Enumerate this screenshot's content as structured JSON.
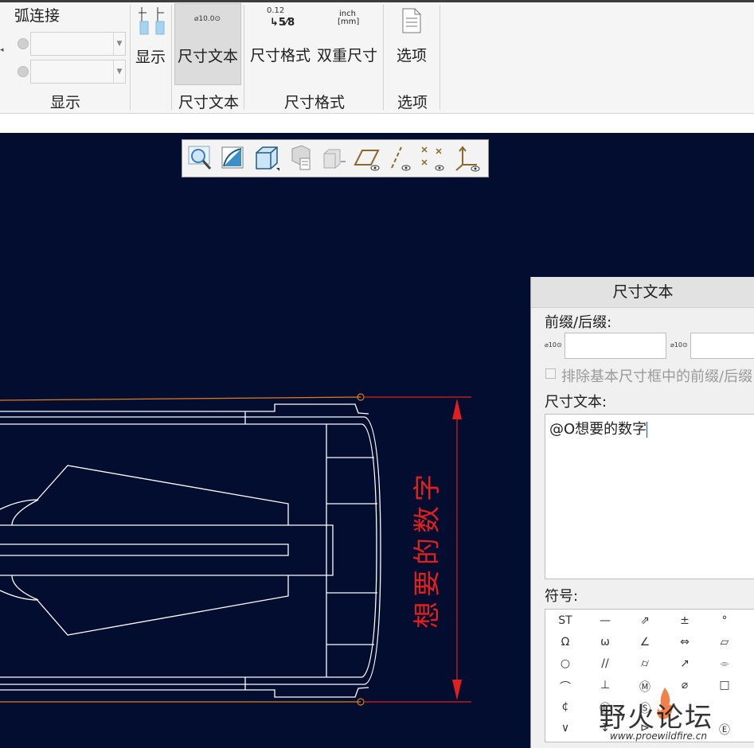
{
  "ribbon": {
    "arc_connect_label": "弧连接",
    "display_button_label": "显示",
    "display_group_label": "显示",
    "dim_text_button_label": "尺寸文本",
    "dim_text_icon_text": "⌀10.0⊙",
    "dim_text_group_label": "尺寸文本",
    "dim_format_button_label": "尺寸格式",
    "dim_format_icon_text": "0.12",
    "dim_format_icon_fraction": "↳5⁄8",
    "dual_dim_button_label": "双重尺寸",
    "dual_dim_icon_top": "inch",
    "dual_dim_icon_bottom": "[mm]",
    "dim_format_group_label": "尺寸格式",
    "options_button_label": "选项",
    "options_group_label": "选项"
  },
  "view_toolbar": {
    "icons": [
      "zoom-icon",
      "shading-icon",
      "solid-cube-icon",
      "saved-views-icon",
      "view-manager-icon",
      "datum-plane-icon",
      "datum-axis-icon",
      "datum-point-icon",
      "coordinate-system-icon"
    ]
  },
  "drawing": {
    "dimension_text": "想要的数字",
    "colors": {
      "background": "#020d2f",
      "geometry": "#ffffff",
      "dimension": "#e0201f",
      "extension": "#e07b1e"
    }
  },
  "dialog": {
    "title": "尺寸文本",
    "prefix_suffix_label": "前缀/后缀:",
    "prefix_icon_text": "⌀10⊙",
    "suffix_icon_text": "⌀10⊙",
    "prefix_value": "",
    "suffix_value": "",
    "exclude_checkbox_label": "排除基本尺寸框中的前缀/后缀",
    "dim_text_label": "尺寸文本:",
    "dim_text_value": "@O想要的数字",
    "symbols_label": "符号:",
    "symbols": [
      [
        "ST",
        "—",
        "⇗",
        "±",
        "°"
      ],
      [
        "Ω",
        "ω",
        "∠",
        "⇔",
        "▱"
      ],
      [
        "○",
        "//",
        "⌭",
        "↗",
        "⌯"
      ],
      [
        "⌒",
        "⊥",
        "Ⓜ",
        "⌀",
        "□"
      ],
      [
        "¢",
        "Ⓛ",
        "Ⓢ",
        "",
        ""
      ],
      [
        "∨",
        "↧",
        "⊳",
        "",
        "Ⓔ"
      ]
    ]
  },
  "watermark": {
    "brand_text": "野火论坛",
    "url_text": "www.proewildfire.cn"
  }
}
